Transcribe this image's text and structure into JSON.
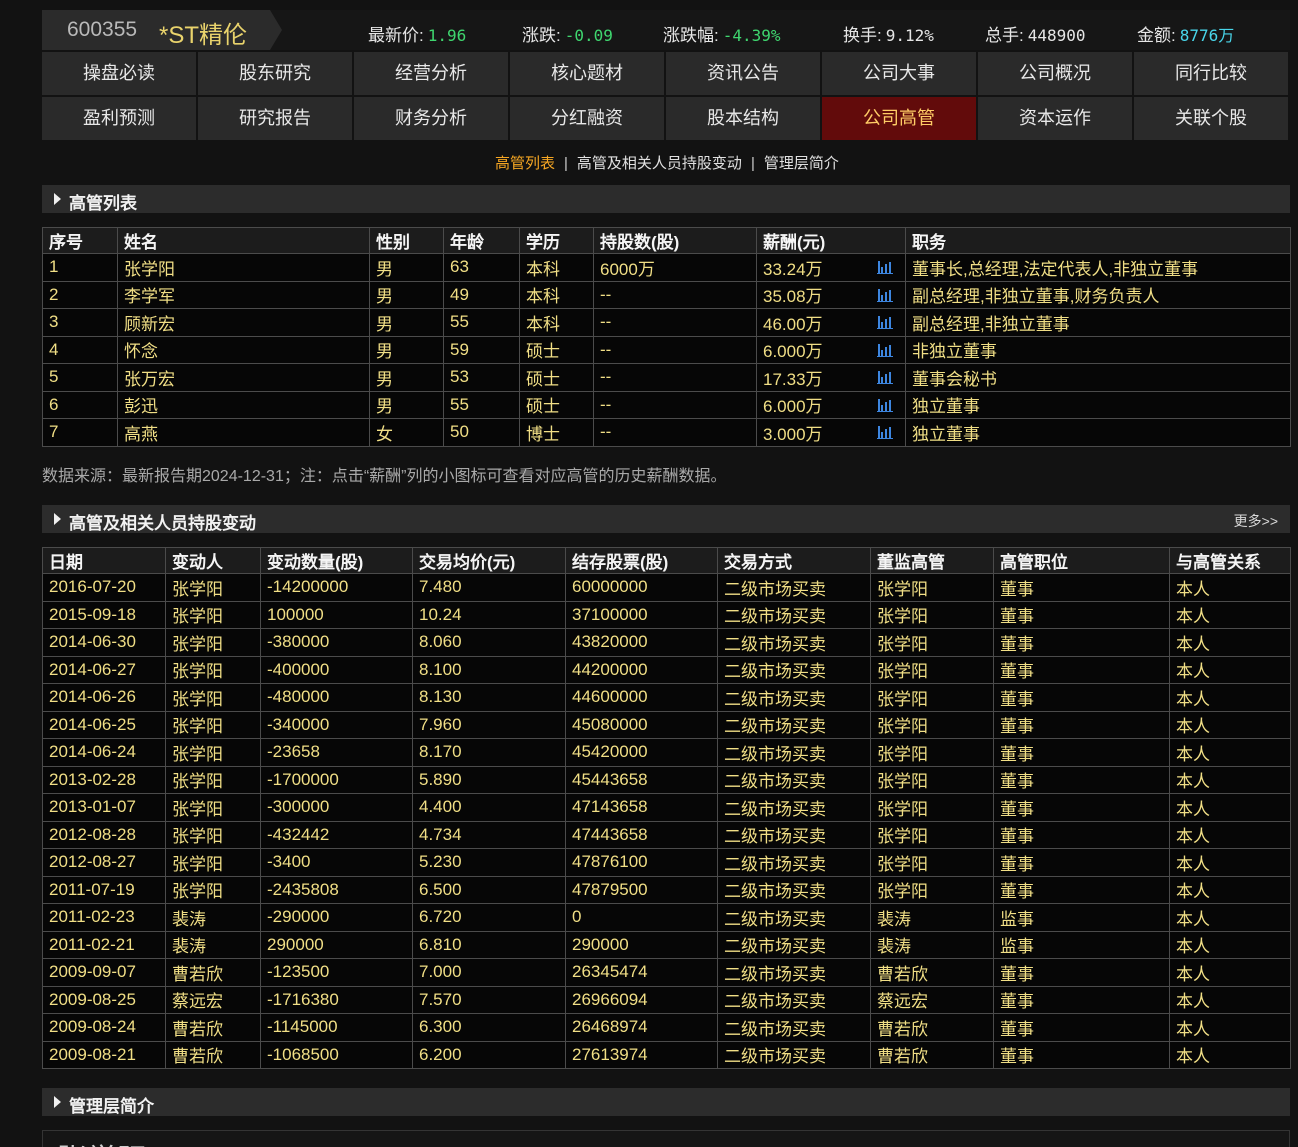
{
  "quote": {
    "code": "600355",
    "name": "*ST精伦",
    "price_label": "最新价:",
    "price": "1.96",
    "change_label": "涨跌:",
    "change": "-0.09",
    "pct_label": "涨跌幅:",
    "pct": "-4.39%",
    "turnover_label": "换手:",
    "turnover": "9.12%",
    "volume_label": "总手:",
    "volume": "448900",
    "amount_label": "金额:",
    "amount": "8776万"
  },
  "nav": {
    "items": [
      "操盘必读",
      "股东研究",
      "经营分析",
      "核心题材",
      "资讯公告",
      "公司大事",
      "公司概况",
      "同行比较",
      "盈利预测",
      "研究报告",
      "财务分析",
      "分红融资",
      "股本结构",
      "公司高管",
      "资本运作",
      "关联个股"
    ],
    "active": "公司高管"
  },
  "subnav": {
    "items": [
      "高管列表",
      "高管及相关人员持股变动",
      "管理层简介"
    ],
    "active": "高管列表",
    "separator": "|"
  },
  "section1": {
    "title": "高管列表"
  },
  "exec_table": {
    "headers": [
      "序号",
      "姓名",
      "性别",
      "年龄",
      "学历",
      "持股数(股)",
      "薪酬(元)",
      "职务"
    ],
    "icon_column": 6,
    "rows": [
      [
        "1",
        "张学阳",
        "男",
        "63",
        "本科",
        "6000万",
        "33.24万",
        "董事长,总经理,法定代表人,非独立董事"
      ],
      [
        "2",
        "李学军",
        "男",
        "49",
        "本科",
        "--",
        "35.08万",
        "副总经理,非独立董事,财务负责人"
      ],
      [
        "3",
        "顾新宏",
        "男",
        "55",
        "本科",
        "--",
        "46.00万",
        "副总经理,非独立董事"
      ],
      [
        "4",
        "怀念",
        "男",
        "59",
        "硕士",
        "--",
        "6.000万",
        "非独立董事"
      ],
      [
        "5",
        "张万宏",
        "男",
        "53",
        "硕士",
        "--",
        "17.33万",
        "董事会秘书"
      ],
      [
        "6",
        "彭迅",
        "男",
        "55",
        "硕士",
        "--",
        "6.000万",
        "独立董事"
      ],
      [
        "7",
        "高燕",
        "女",
        "50",
        "博士",
        "--",
        "3.000万",
        "独立董事"
      ]
    ]
  },
  "note": "数据来源：最新报告期2024-12-31；注：点击“薪酬”列的小图标可查看对应高管的历史薪酬数据。",
  "section2": {
    "title": "高管及相关人员持股变动",
    "more": "更多>>"
  },
  "holding_table": {
    "headers": [
      "日期",
      "变动人",
      "变动数量(股)",
      "交易均价(元)",
      "结存股票(股)",
      "交易方式",
      "董监高管",
      "高管职位",
      "与高管关系"
    ],
    "rows": [
      [
        "2016-07-20",
        "张学阳",
        "-14200000",
        "7.480",
        "60000000",
        "二级市场买卖",
        "张学阳",
        "董事",
        "本人"
      ],
      [
        "2015-09-18",
        "张学阳",
        "100000",
        "10.24",
        "37100000",
        "二级市场买卖",
        "张学阳",
        "董事",
        "本人"
      ],
      [
        "2014-06-30",
        "张学阳",
        "-380000",
        "8.060",
        "43820000",
        "二级市场买卖",
        "张学阳",
        "董事",
        "本人"
      ],
      [
        "2014-06-27",
        "张学阳",
        "-400000",
        "8.100",
        "44200000",
        "二级市场买卖",
        "张学阳",
        "董事",
        "本人"
      ],
      [
        "2014-06-26",
        "张学阳",
        "-480000",
        "8.130",
        "44600000",
        "二级市场买卖",
        "张学阳",
        "董事",
        "本人"
      ],
      [
        "2014-06-25",
        "张学阳",
        "-340000",
        "7.960",
        "45080000",
        "二级市场买卖",
        "张学阳",
        "董事",
        "本人"
      ],
      [
        "2014-06-24",
        "张学阳",
        "-23658",
        "8.170",
        "45420000",
        "二级市场买卖",
        "张学阳",
        "董事",
        "本人"
      ],
      [
        "2013-02-28",
        "张学阳",
        "-1700000",
        "5.890",
        "45443658",
        "二级市场买卖",
        "张学阳",
        "董事",
        "本人"
      ],
      [
        "2013-01-07",
        "张学阳",
        "-300000",
        "4.400",
        "47143658",
        "二级市场买卖",
        "张学阳",
        "董事",
        "本人"
      ],
      [
        "2012-08-28",
        "张学阳",
        "-432442",
        "4.734",
        "47443658",
        "二级市场买卖",
        "张学阳",
        "董事",
        "本人"
      ],
      [
        "2012-08-27",
        "张学阳",
        "-3400",
        "5.230",
        "47876100",
        "二级市场买卖",
        "张学阳",
        "董事",
        "本人"
      ],
      [
        "2011-07-19",
        "张学阳",
        "-2435808",
        "6.500",
        "47879500",
        "二级市场买卖",
        "张学阳",
        "董事",
        "本人"
      ],
      [
        "2011-02-23",
        "裴涛",
        "-290000",
        "6.720",
        "0",
        "二级市场买卖",
        "裴涛",
        "监事",
        "本人"
      ],
      [
        "2011-02-21",
        "裴涛",
        "290000",
        "6.810",
        "290000",
        "二级市场买卖",
        "裴涛",
        "监事",
        "本人"
      ],
      [
        "2009-09-07",
        "曹若欣",
        "-123500",
        "7.000",
        "26345474",
        "二级市场买卖",
        "曹若欣",
        "董事",
        "本人"
      ],
      [
        "2009-08-25",
        "蔡远宏",
        "-1716380",
        "7.570",
        "26966094",
        "二级市场买卖",
        "蔡远宏",
        "董事",
        "本人"
      ],
      [
        "2009-08-24",
        "曹若欣",
        "-1145000",
        "6.300",
        "26468974",
        "二级市场买卖",
        "曹若欣",
        "董事",
        "本人"
      ],
      [
        "2009-08-21",
        "曹若欣",
        "-1068500",
        "6.200",
        "27613974",
        "二级市场买卖",
        "曹若欣",
        "董事",
        "本人"
      ]
    ]
  },
  "section3": {
    "title": "管理层简介"
  },
  "bio": {
    "name": "张学阳"
  },
  "colors": {
    "up_down": "#3fd66f",
    "amount": "#49d6ea",
    "stock_name": "#e9d36c",
    "cell_text": "#f1df86",
    "active_tab_bg": "#620b0b",
    "active_tab_text": "#ffcc66",
    "active_subnav": "#f5a623",
    "salary_icon": "#3d86e0"
  },
  "icons": {
    "section_arrow": "triangle-right-icon",
    "salary_chart": "bar-chart-icon"
  }
}
